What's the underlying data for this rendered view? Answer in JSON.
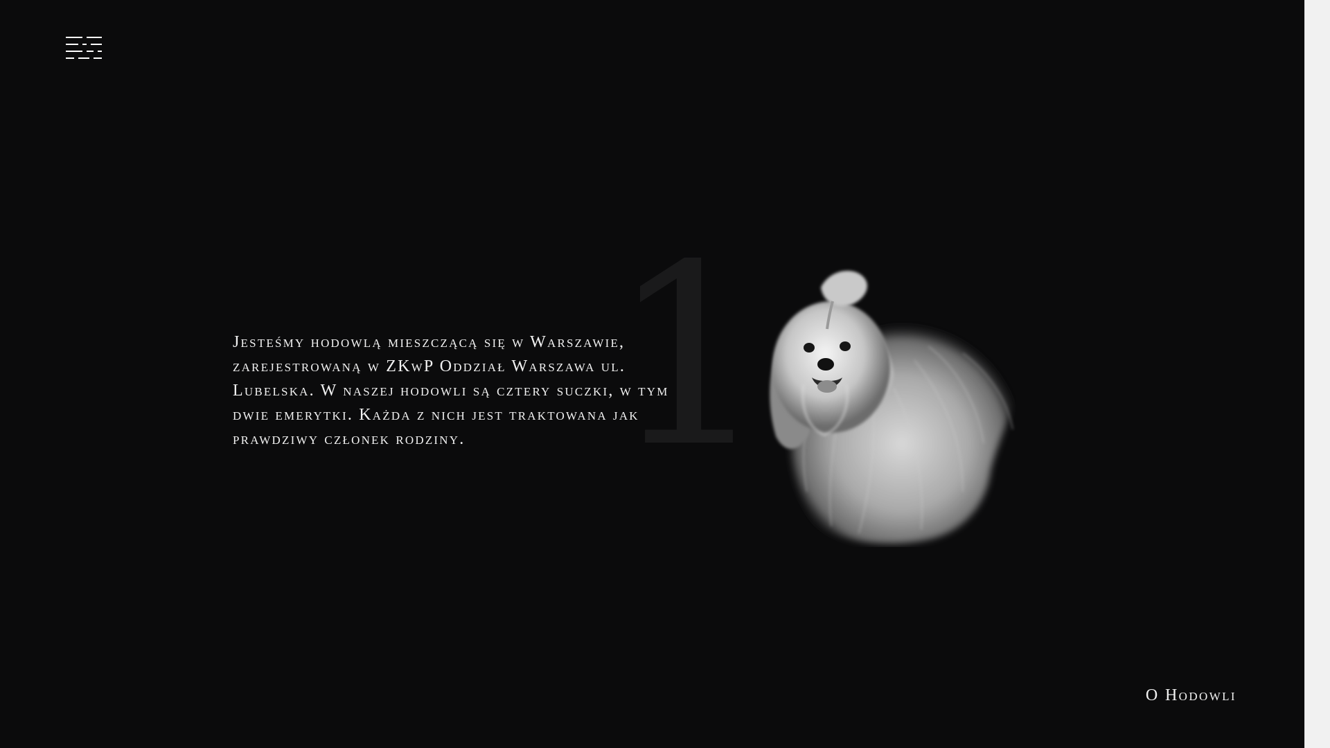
{
  "menu": {
    "icon": "hamburger-menu-icon"
  },
  "hero": {
    "numeral": "1",
    "text": "Jesteśmy hodowlą mieszczącą się w Warszawie, zarejestrowaną w ZKwP Oddział Warszawa ul. Lubelska. W naszej hodowli są cztery suczki, w tym dwie emerytki. Każda z nich jest traktowana jak prawdziwy członek rodziny.",
    "image_icon": "maltese-dog-icon"
  },
  "footer": {
    "section_label": "O Hodowli"
  },
  "colors": {
    "background": "#0b0b0c",
    "text": "#f2f2f2",
    "numeral": "#1a1a1b",
    "scrollbar": "#f1f1f1"
  }
}
